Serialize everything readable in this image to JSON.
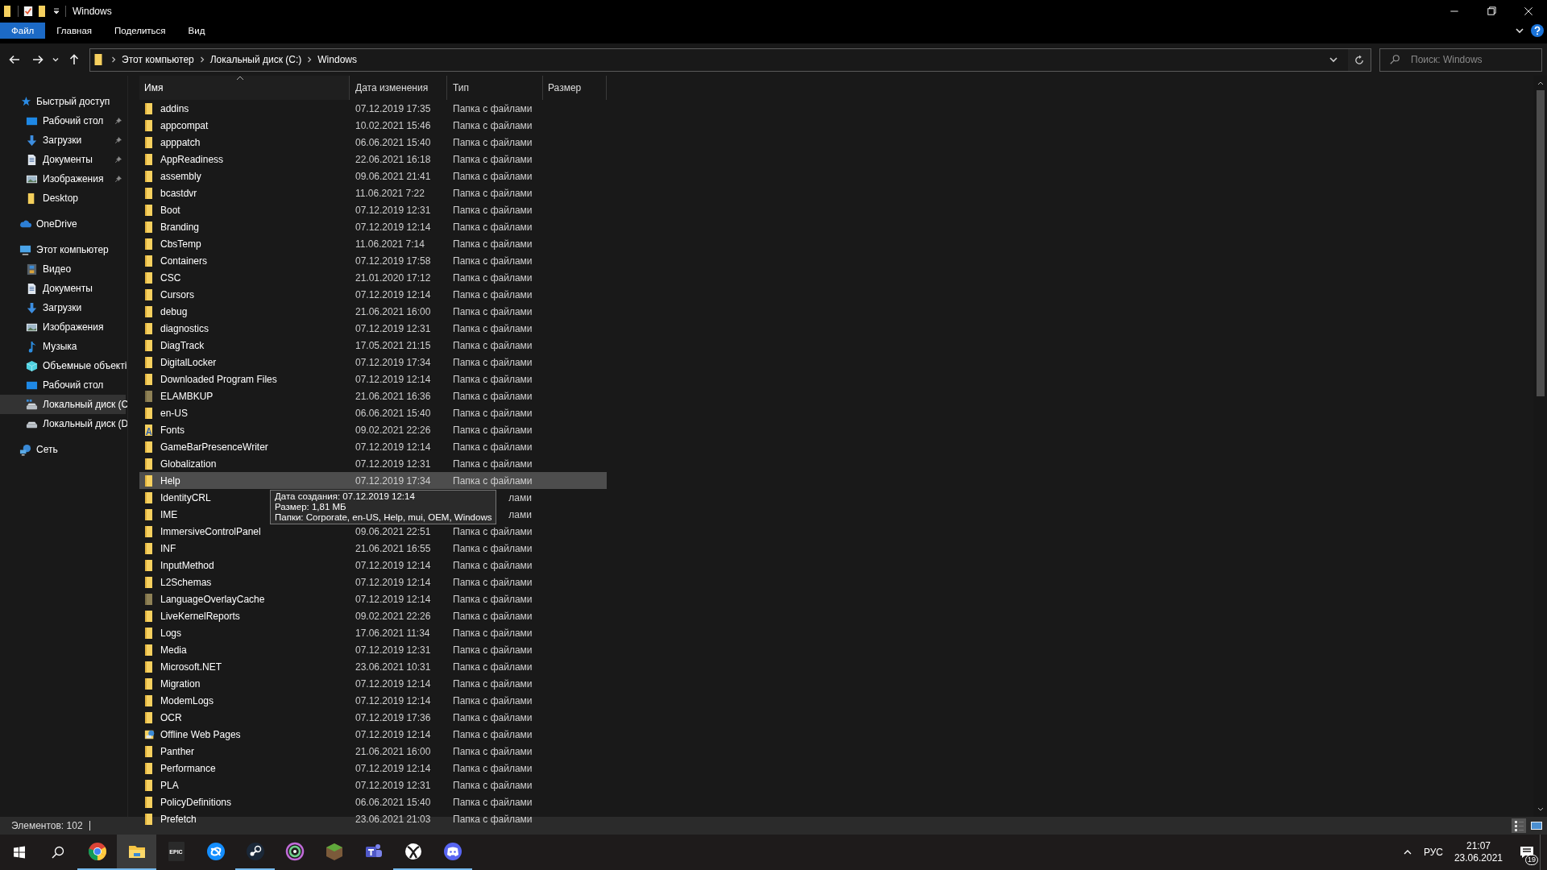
{
  "window": {
    "title": "Windows"
  },
  "ribbon_tabs": [
    {
      "label": "Файл",
      "selected": true
    },
    {
      "label": "Главная",
      "selected": false
    },
    {
      "label": "Поделиться",
      "selected": false
    },
    {
      "label": "Вид",
      "selected": false
    }
  ],
  "address_bar": {
    "crumbs": [
      "Этот компьютер",
      "Локальный диск (C:)",
      "Windows"
    ]
  },
  "search": {
    "placeholder": "Поиск: Windows"
  },
  "sidebar": {
    "items": [
      {
        "label": "Быстрый доступ",
        "kind": "star",
        "selected": false,
        "children": [
          {
            "label": "Рабочий стол",
            "kind": "desktop",
            "pinned": true,
            "selected": false
          },
          {
            "label": "Загрузки",
            "kind": "downloads",
            "pinned": true,
            "selected": false
          },
          {
            "label": "Документы",
            "kind": "documents",
            "pinned": true,
            "selected": false
          },
          {
            "label": "Изображения",
            "kind": "pictures",
            "pinned": true,
            "selected": false
          },
          {
            "label": "Desktop",
            "kind": "folder",
            "pinned": false,
            "selected": false
          }
        ]
      },
      {
        "label": "OneDrive",
        "kind": "cloud",
        "selected": false
      },
      {
        "label": "Этот компьютер",
        "kind": "computer",
        "selected": false,
        "children": [
          {
            "label": "Видео",
            "kind": "video",
            "pinned": false,
            "selected": false
          },
          {
            "label": "Документы",
            "kind": "documents",
            "pinned": false,
            "selected": false
          },
          {
            "label": "Загрузки",
            "kind": "downloads",
            "pinned": false,
            "selected": false
          },
          {
            "label": "Изображения",
            "kind": "pictures",
            "pinned": false,
            "selected": false
          },
          {
            "label": "Музыка",
            "kind": "music",
            "pinned": false,
            "selected": false
          },
          {
            "label": "Объемные объекті",
            "kind": "objects",
            "pinned": false,
            "selected": false
          },
          {
            "label": "Рабочий стол",
            "kind": "desktop",
            "pinned": false,
            "selected": false
          },
          {
            "label": "Локальный диск (С",
            "kind": "systemdrive",
            "pinned": false,
            "selected": true
          },
          {
            "label": "Локальный диск (D",
            "kind": "drive",
            "pinned": false,
            "selected": false
          }
        ]
      },
      {
        "label": "Сеть",
        "kind": "network",
        "selected": false
      }
    ]
  },
  "table": {
    "columns": [
      {
        "label": "Имя",
        "sorted": true
      },
      {
        "label": "Дата изменения",
        "sorted": false
      },
      {
        "label": "Тип",
        "sorted": false
      },
      {
        "label": "Размер",
        "sorted": false
      }
    ],
    "rows": [
      {
        "name": "addins",
        "date": "07.12.2019 17:35",
        "type": "Папка с файлами",
        "kind": "folder",
        "selected": false
      },
      {
        "name": "appcompat",
        "date": "10.02.2021 15:46",
        "type": "Папка с файлами",
        "kind": "folder",
        "selected": false
      },
      {
        "name": "apppatch",
        "date": "06.06.2021 15:40",
        "type": "Папка с файлами",
        "kind": "folder",
        "selected": false
      },
      {
        "name": "AppReadiness",
        "date": "22.06.2021 16:18",
        "type": "Папка с файлами",
        "kind": "folder",
        "selected": false
      },
      {
        "name": "assembly",
        "date": "09.06.2021 21:41",
        "type": "Папка с файлами",
        "kind": "folder",
        "selected": false
      },
      {
        "name": "bcastdvr",
        "date": "11.06.2021 7:22",
        "type": "Папка с файлами",
        "kind": "folder",
        "selected": false
      },
      {
        "name": "Boot",
        "date": "07.12.2019 12:31",
        "type": "Папка с файлами",
        "kind": "folder",
        "selected": false
      },
      {
        "name": "Branding",
        "date": "07.12.2019 12:14",
        "type": "Папка с файлами",
        "kind": "folder",
        "selected": false
      },
      {
        "name": "CbsTemp",
        "date": "11.06.2021 7:14",
        "type": "Папка с файлами",
        "kind": "folder",
        "selected": false
      },
      {
        "name": "Containers",
        "date": "07.12.2019 17:58",
        "type": "Папка с файлами",
        "kind": "folder",
        "selected": false
      },
      {
        "name": "CSC",
        "date": "21.01.2020 17:12",
        "type": "Папка с файлами",
        "kind": "folder",
        "selected": false
      },
      {
        "name": "Cursors",
        "date": "07.12.2019 12:14",
        "type": "Папка с файлами",
        "kind": "folder",
        "selected": false
      },
      {
        "name": "debug",
        "date": "21.06.2021 16:00",
        "type": "Папка с файлами",
        "kind": "folder",
        "selected": false
      },
      {
        "name": "diagnostics",
        "date": "07.12.2019 12:31",
        "type": "Папка с файлами",
        "kind": "folder",
        "selected": false
      },
      {
        "name": "DiagTrack",
        "date": "17.05.2021 21:15",
        "type": "Папка с файлами",
        "kind": "folder",
        "selected": false
      },
      {
        "name": "DigitalLocker",
        "date": "07.12.2019 17:34",
        "type": "Папка с файлами",
        "kind": "folder",
        "selected": false
      },
      {
        "name": "Downloaded Program Files",
        "date": "07.12.2019 12:14",
        "type": "Папка с файлами",
        "kind": "folder",
        "selected": false
      },
      {
        "name": "ELAMBKUP",
        "date": "21.06.2021 16:36",
        "type": "Папка с файлами",
        "kind": "hidden",
        "selected": false
      },
      {
        "name": "en-US",
        "date": "06.06.2021 15:40",
        "type": "Папка с файлами",
        "kind": "folder",
        "selected": false
      },
      {
        "name": "Fonts",
        "date": "09.02.2021 22:26",
        "type": "Папка с файлами",
        "kind": "fonts",
        "selected": false
      },
      {
        "name": "GameBarPresenceWriter",
        "date": "07.12.2019 12:14",
        "type": "Папка с файлами",
        "kind": "folder",
        "selected": false
      },
      {
        "name": "Globalization",
        "date": "07.12.2019 12:31",
        "type": "Папка с файлами",
        "kind": "folder",
        "selected": false
      },
      {
        "name": "Help",
        "date": "07.12.2019 17:34",
        "type": "Папка с файлами",
        "kind": "folder",
        "selected": true
      },
      {
        "name": "IdentityCRL",
        "type": "лами",
        "kind": "folder",
        "selected": false
      },
      {
        "name": "IME",
        "type": "лами",
        "kind": "folder",
        "selected": false
      },
      {
        "name": "ImmersiveControlPanel",
        "date": "09.06.2021 22:51",
        "type": "Папка с файлами",
        "kind": "folder",
        "selected": false
      },
      {
        "name": "INF",
        "date": "21.06.2021 16:55",
        "type": "Папка с файлами",
        "kind": "folder",
        "selected": false
      },
      {
        "name": "InputMethod",
        "date": "07.12.2019 12:14",
        "type": "Папка с файлами",
        "kind": "folder",
        "selected": false
      },
      {
        "name": "L2Schemas",
        "date": "07.12.2019 12:14",
        "type": "Папка с файлами",
        "kind": "folder",
        "selected": false
      },
      {
        "name": "LanguageOverlayCache",
        "date": "07.12.2019 12:14",
        "type": "Папка с файлами",
        "kind": "hidden",
        "selected": false
      },
      {
        "name": "LiveKernelReports",
        "date": "09.02.2021 22:26",
        "type": "Папка с файлами",
        "kind": "folder",
        "selected": false
      },
      {
        "name": "Logs",
        "date": "17.06.2021 11:34",
        "type": "Папка с файлами",
        "kind": "folder",
        "selected": false
      },
      {
        "name": "Media",
        "date": "07.12.2019 12:31",
        "type": "Папка с файлами",
        "kind": "folder",
        "selected": false
      },
      {
        "name": "Microsoft.NET",
        "date": "23.06.2021 10:31",
        "type": "Папка с файлами",
        "kind": "folder",
        "selected": false
      },
      {
        "name": "Migration",
        "date": "07.12.2019 12:14",
        "type": "Папка с файлами",
        "kind": "folder",
        "selected": false
      },
      {
        "name": "ModemLogs",
        "date": "07.12.2019 12:14",
        "type": "Папка с файлами",
        "kind": "folder",
        "selected": false
      },
      {
        "name": "OCR",
        "date": "07.12.2019 17:36",
        "type": "Папка с файлами",
        "kind": "folder",
        "selected": false
      },
      {
        "name": "Offline Web Pages",
        "date": "07.12.2019 12:14",
        "type": "Папка с файлами",
        "kind": "web",
        "selected": false
      },
      {
        "name": "Panther",
        "date": "21.06.2021 16:00",
        "type": "Папка с файлами",
        "kind": "folder",
        "selected": false
      },
      {
        "name": "Performance",
        "date": "07.12.2019 12:14",
        "type": "Папка с файлами",
        "kind": "folder",
        "selected": false
      },
      {
        "name": "PLA",
        "date": "07.12.2019 12:31",
        "type": "Папка с файлами",
        "kind": "folder",
        "selected": false
      },
      {
        "name": "PolicyDefinitions",
        "date": "06.06.2021 15:40",
        "type": "Папка с файлами",
        "kind": "folder",
        "selected": false
      },
      {
        "name": "Prefetch",
        "date": "23.06.2021 21:03",
        "type": "Папка с файлами",
        "kind": "folder",
        "selected": false
      }
    ]
  },
  "tooltip": {
    "lines": [
      "Дата создания: 07.12.2019 12:14",
      "Размер: 1,81 МБ",
      "Папки: Corporate, en-US, Help, mui, OEM, Windows"
    ]
  },
  "status_bar": {
    "count": "Элементов: 102",
    "views": [
      {
        "kind": "details",
        "selected": true
      },
      {
        "kind": "tiles",
        "selected": false
      }
    ]
  },
  "taskbar": {
    "apps": [
      {
        "kind": "chrome",
        "running": true,
        "selected": false
      },
      {
        "kind": "explorer",
        "running": true,
        "selected": true
      },
      {
        "kind": "epic",
        "label": "EPIC",
        "running": false,
        "selected": false
      },
      {
        "kind": "battlenet",
        "running": false,
        "selected": false
      },
      {
        "kind": "steam",
        "running": true,
        "selected": false
      },
      {
        "kind": "ubisoft",
        "running": false,
        "selected": false
      },
      {
        "kind": "minecraft",
        "running": false,
        "selected": false
      },
      {
        "kind": "teams",
        "running": false,
        "selected": false
      },
      {
        "kind": "xbox",
        "running": true,
        "selected": false
      },
      {
        "kind": "discord",
        "running": true,
        "selected": false
      }
    ],
    "language": "РУС",
    "time": "21:07",
    "date": "23.06.2021",
    "notifications": "19"
  }
}
